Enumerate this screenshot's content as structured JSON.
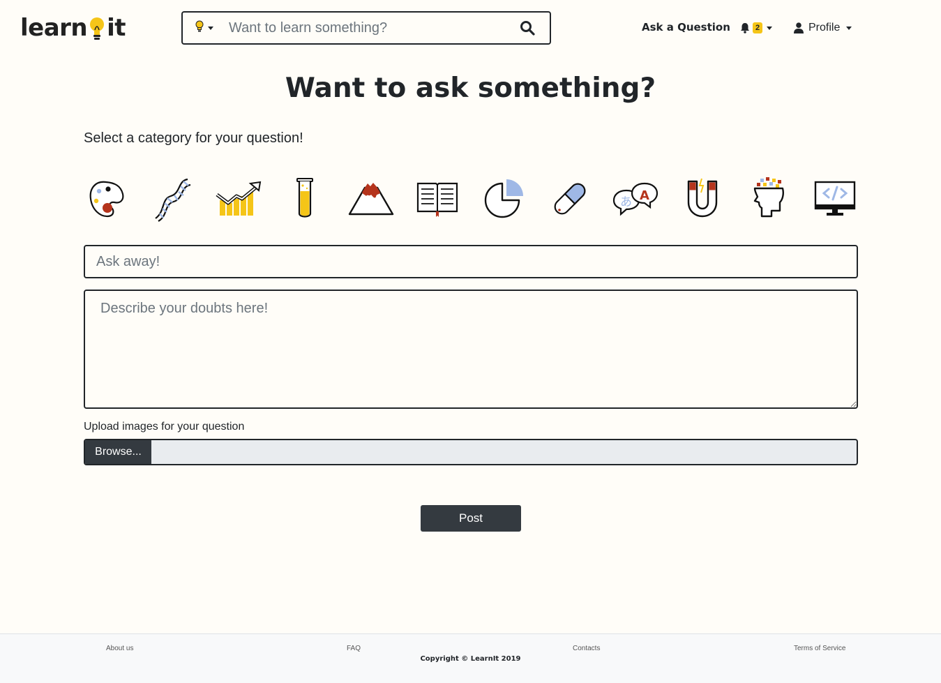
{
  "brand": {
    "name_part1": "learn",
    "name_part2": "it",
    "accent_color": "#f5c518"
  },
  "navbar": {
    "search": {
      "placeholder": "Want to learn something?",
      "category_icon": "lightbulb-icon",
      "button_icon": "search-icon"
    },
    "ask_label": "Ask a Question",
    "notifications": {
      "icon": "bell-icon",
      "count": "2"
    },
    "profile": {
      "icon": "user-icon",
      "label": "Profile"
    }
  },
  "main": {
    "title": "Want to ask something?",
    "category_prompt": "Select a category for your question!",
    "categories": [
      {
        "icon": "palette-icon"
      },
      {
        "icon": "dna-icon"
      },
      {
        "icon": "growth-chart-icon"
      },
      {
        "icon": "test-tube-icon"
      },
      {
        "icon": "volcano-icon"
      },
      {
        "icon": "book-icon"
      },
      {
        "icon": "pie-chart-icon"
      },
      {
        "icon": "pill-icon"
      },
      {
        "icon": "language-bubbles-icon"
      },
      {
        "icon": "magnet-icon"
      },
      {
        "icon": "mind-head-icon"
      },
      {
        "icon": "code-monitor-icon"
      }
    ],
    "question_title_placeholder": "Ask away!",
    "description_placeholder": "Describe your doubts here!",
    "upload_label": "Upload images for your question",
    "browse_label": "Browse...",
    "post_label": "Post"
  },
  "footer": {
    "about": "About us",
    "faq": "FAQ",
    "contacts": "Contacts",
    "terms": "Terms of Service",
    "copyright": "Copyright © LearnIt 2019"
  }
}
